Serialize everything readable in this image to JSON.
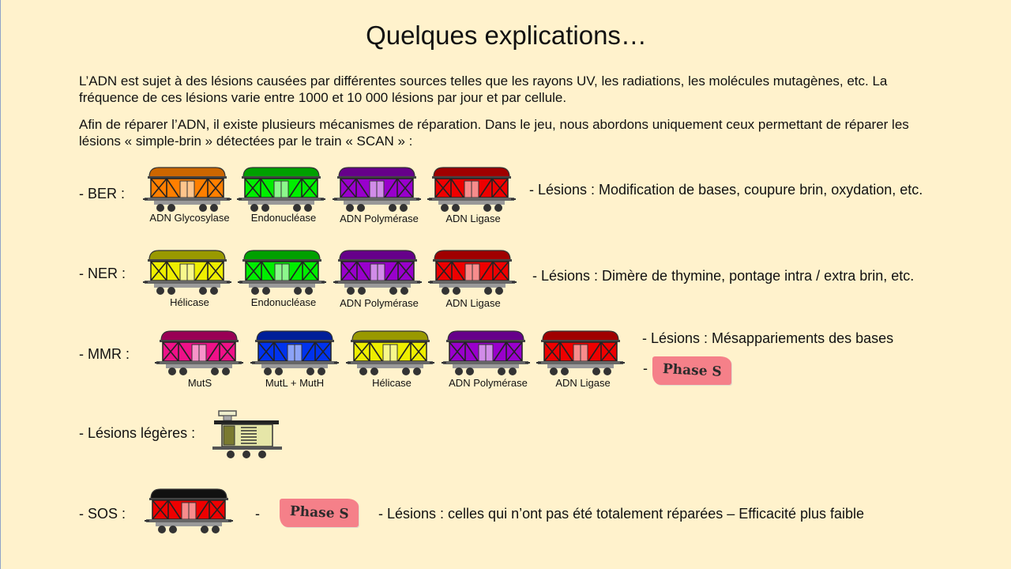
{
  "title": "Quelques explications…",
  "intro": {
    "p1": "L’ADN est sujet à des lésions causées par différentes  sources telles que les rayons UV, les radiations, les molécules mutagènes, etc. La fréquence  de ces lésions varie entre 1000 et 10 000 lésions par jour et par cellule.",
    "p2": "Afin de réparer  l’ADN, il existe plusieurs mécanismes de réparation. Dans le jeu, nous abordons uniquement ceux permettant de réparer les lésions « simple-brin » détectées par le train « SCAN » :"
  },
  "rows": {
    "ber": {
      "label": "-    BER :",
      "lesions": "- Lésions : Modification de bases, coupure brin, oxydation, etc.",
      "wagons": [
        {
          "caption": "ADN Glycosylase",
          "color": "#ff7f00",
          "roof": "#cc6600"
        },
        {
          "caption": "Endonucléase",
          "color": "#00ee00",
          "roof": "#00a000"
        },
        {
          "caption": "ADN Polymérase",
          "color": "#9900cc",
          "roof": "#66008a"
        },
        {
          "caption": "ADN Ligase",
          "color": "#ee0000",
          "roof": "#a00000"
        }
      ]
    },
    "ner": {
      "label": "-    NER :",
      "lesions": "- Lésions : Dimère de thymine, pontage intra / extra brin, etc.",
      "wagons": [
        {
          "caption": "Hélicase",
          "color": "#eeee00",
          "roof": "#999900"
        },
        {
          "caption": "Endonucléase",
          "color": "#00ee00",
          "roof": "#00a000"
        },
        {
          "caption": "ADN Polymérase",
          "color": "#9900cc",
          "roof": "#66008a"
        },
        {
          "caption": "ADN Ligase",
          "color": "#ee0000",
          "roof": "#a00000"
        }
      ]
    },
    "mmr": {
      "label": "-    MMR :",
      "lesions": "- Lésions : Mésappariements  des bases",
      "dash": "-",
      "phase": "Phase S",
      "wagons": [
        {
          "caption": "MutS",
          "color": "#ee1188",
          "roof": "#990055"
        },
        {
          "caption": "MutL + MutH",
          "color": "#0033ee",
          "roof": "#001f99"
        },
        {
          "caption": "Hélicase",
          "color": "#eeee00",
          "roof": "#999900"
        },
        {
          "caption": "ADN Polymérase",
          "color": "#9900cc",
          "roof": "#66008a"
        },
        {
          "caption": "ADN Ligase",
          "color": "#ee0000",
          "roof": "#a00000"
        }
      ]
    },
    "light": {
      "label": "-    Lésions légères :"
    },
    "sos": {
      "label": "-    SOS :",
      "dash": "-",
      "phase": "Phase S",
      "lesions": "- Lésions : celles qui n’ont pas été totalement réparées – Efficacité plus faible",
      "wagon": {
        "color": "#ee0000",
        "roof": "#111111"
      }
    }
  }
}
